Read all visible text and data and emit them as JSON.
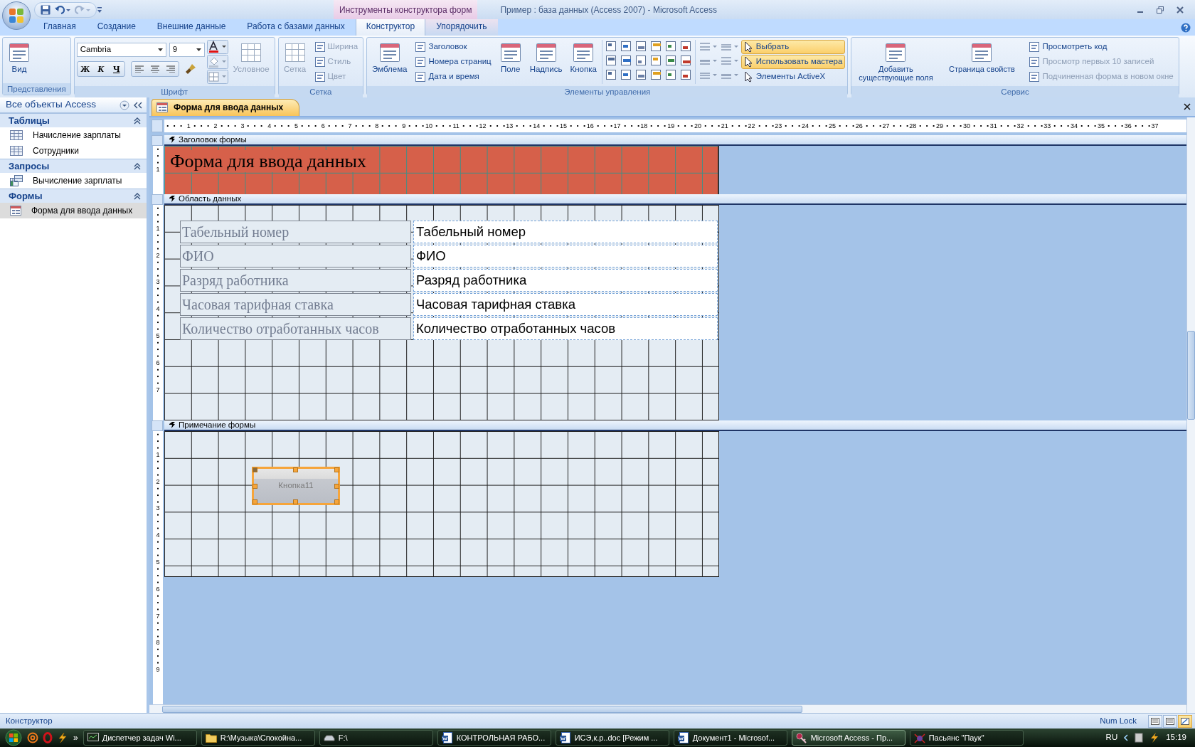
{
  "window": {
    "title": "Пример : база данных (Access 2007) - Microsoft Access",
    "context_group": "Инструменты конструктора форм"
  },
  "ribbon_tabs": [
    {
      "label": "Главная",
      "selected": false,
      "contextual": false
    },
    {
      "label": "Создание",
      "selected": false,
      "contextual": false
    },
    {
      "label": "Внешние данные",
      "selected": false,
      "contextual": false
    },
    {
      "label": "Работа с базами данных",
      "selected": false,
      "contextual": false
    },
    {
      "label": "Конструктор",
      "selected": true,
      "contextual": true
    },
    {
      "label": "Упорядочить",
      "selected": false,
      "contextual": true
    }
  ],
  "ribbon_groups": [
    {
      "label": "Представления",
      "items": [
        {
          "kind": "large",
          "label": "Вид",
          "disabled": false,
          "on": false
        }
      ]
    },
    {
      "label": "Шрифт",
      "font": "Cambria",
      "size": "9",
      "format_buttons": [
        "Ж",
        "К",
        "Ч"
      ],
      "items": [
        {
          "kind": "large",
          "label": "Условное",
          "disabled": true,
          "on": false
        }
      ]
    },
    {
      "label": "Сетка",
      "items": [
        {
          "kind": "large",
          "label": "Сетка",
          "disabled": true,
          "on": false
        },
        {
          "kind": "small",
          "label": "Ширина",
          "disabled": true,
          "on": false
        },
        {
          "kind": "small",
          "label": "Стиль",
          "disabled": true,
          "on": false
        },
        {
          "kind": "small",
          "label": "Цвет",
          "disabled": true,
          "on": false
        }
      ]
    },
    {
      "label": "Элементы управления",
      "items": [
        {
          "kind": "large",
          "label": "Эмблема",
          "disabled": false,
          "on": false
        },
        {
          "kind": "small",
          "label": "Заголовок",
          "disabled": false,
          "on": false
        },
        {
          "kind": "small",
          "label": "Номера страниц",
          "disabled": false,
          "on": false
        },
        {
          "kind": "small",
          "label": "Дата и время",
          "disabled": false,
          "on": false
        },
        {
          "kind": "large",
          "label": "Поле",
          "disabled": false,
          "on": false
        },
        {
          "kind": "large",
          "label": "Надпись",
          "disabled": false,
          "on": false
        },
        {
          "kind": "large",
          "label": "Кнопка",
          "disabled": false,
          "on": false
        },
        {
          "kind": "toolbox",
          "disabled": false,
          "on": false
        },
        {
          "kind": "toggle",
          "label": "Выбрать",
          "disabled": false,
          "on": true
        },
        {
          "kind": "toggle",
          "label": "Использовать мастера",
          "disabled": false,
          "on": true
        },
        {
          "kind": "toggle",
          "label": "Элементы ActiveX",
          "disabled": false,
          "on": false
        }
      ]
    },
    {
      "label": "Сервис",
      "items": [
        {
          "kind": "large",
          "label": "Добавить существующие поля",
          "disabled": false,
          "on": false
        },
        {
          "kind": "large",
          "label": "Страница свойств",
          "disabled": false,
          "on": false
        },
        {
          "kind": "small",
          "label": "Просмотреть код",
          "disabled": false,
          "on": false
        },
        {
          "kind": "small",
          "label": "Просмотр первых 10 записей",
          "disabled": true,
          "on": false
        },
        {
          "kind": "small",
          "label": "Подчиненная форма в новом окне",
          "disabled": true,
          "on": false
        }
      ]
    }
  ],
  "nav_pane": {
    "title": "Все объекты Access",
    "groups": [
      {
        "title": "Таблицы",
        "kind": "table",
        "expanded": true,
        "items": [
          {
            "label": "Начисление зарплаты",
            "selected": false
          },
          {
            "label": "Сотрудники",
            "selected": false
          }
        ]
      },
      {
        "title": "Запросы",
        "kind": "query",
        "expanded": true,
        "items": [
          {
            "label": "Вычисление зарплаты",
            "selected": false
          }
        ]
      },
      {
        "title": "Формы",
        "kind": "form",
        "expanded": true,
        "items": [
          {
            "label": "Форма для ввода данных",
            "selected": true
          }
        ]
      }
    ]
  },
  "document_tabs": [
    {
      "label": "Форма для ввода данных",
      "selected": true
    }
  ],
  "ruler": {
    "marks": [
      "1",
      "2",
      "3",
      "4",
      "5",
      "6",
      "7",
      "8",
      "9",
      "10",
      "11",
      "12",
      "13",
      "14",
      "15",
      "16",
      "17",
      "18",
      "19",
      "20",
      "21",
      "22",
      "23",
      "24",
      "25",
      "26",
      "27",
      "28",
      "29",
      "30",
      "31",
      "32",
      "33",
      "34",
      "35",
      "36",
      "37"
    ]
  },
  "form_sections": [
    {
      "kind": "header",
      "title": "Заголовок формы",
      "ruler_marks": [
        "1"
      ],
      "caption": "Форма для ввода данных"
    },
    {
      "kind": "detail",
      "title": "Область данных",
      "ruler_marks": [
        "1",
        "2",
        "3",
        "4",
        "5",
        "6",
        "7"
      ],
      "fields": [
        {
          "label": "Табельный номер",
          "control": "Табельный номер"
        },
        {
          "label": "ФИО",
          "control": "ФИО"
        },
        {
          "label": "Разряд работника",
          "control": "Разряд работника"
        },
        {
          "label": "Часовая тарифная ставка",
          "control": "Часовая тарифная ставка"
        },
        {
          "label": "Количество отработанных часов",
          "control": "Количество отработанных часов"
        }
      ]
    },
    {
      "kind": "footer",
      "title": "Примечание формы",
      "ruler_marks": [
        "1",
        "2",
        "3",
        "4",
        "5",
        "6",
        "7",
        "8",
        "9"
      ],
      "button": {
        "label": "Кнопка11",
        "selected": true
      }
    }
  ],
  "status_bar": {
    "mode": "Конструктор",
    "indicator": "Num Lock",
    "view_buttons": [
      {
        "selected": false
      },
      {
        "selected": false
      },
      {
        "selected": true
      }
    ]
  },
  "taskbar": {
    "quick_launch_more": "»",
    "tasks": [
      {
        "label": "Диспетчер задач Wi...",
        "kind": "monitor",
        "selected": false
      },
      {
        "label": "R:\\Музыка\\Спокойна...",
        "kind": "folder",
        "selected": false
      },
      {
        "label": "F:\\",
        "kind": "drive",
        "selected": false
      },
      {
        "label": "КОНТРОЛЬНАЯ РАБО...",
        "kind": "word",
        "selected": false
      },
      {
        "label": "ИСЭ,к.р..doc [Режим ...",
        "kind": "word",
        "selected": false
      },
      {
        "label": "Документ1 - Microsof...",
        "kind": "word",
        "selected": false
      },
      {
        "label": "Microsoft Access - Пр...",
        "kind": "access",
        "selected": true
      },
      {
        "label": "Пасьянс \"Паук\"",
        "kind": "game",
        "selected": false
      }
    ],
    "language": "RU",
    "clock": "15:19"
  }
}
